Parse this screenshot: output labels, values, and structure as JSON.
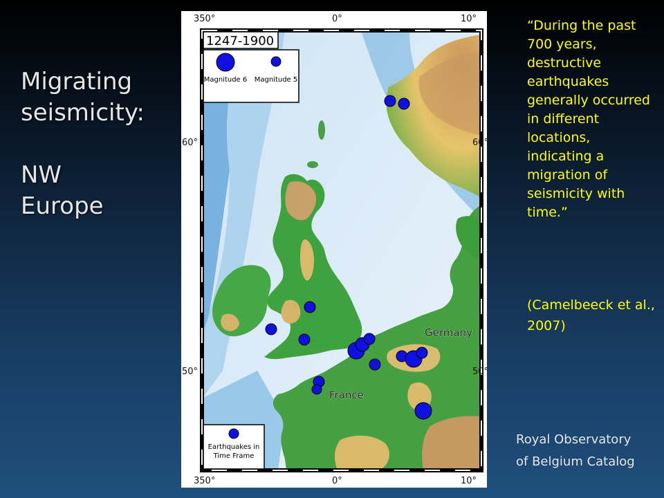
{
  "slide": {
    "title_lines": [
      "Migrating",
      "seismicity:",
      "NW",
      "Europe"
    ],
    "quote": "“During the past 700 years, destructive earthquakes generally occurred in different locations, indicating a migration of seismicity with time.”",
    "citation": "(Camelbeeck et al., 2007)",
    "source_lines": [
      "Royal Observatory",
      "of Belgium Catalog"
    ]
  },
  "map": {
    "period": "1247-1900",
    "legend_magnitude6": "Magnitude 6",
    "legend_magnitude5": "Magnitude 5",
    "legend_timeframe": "Earthquakes in Time Frame",
    "tick_top": [
      "350°",
      "0°",
      "10°"
    ],
    "tick_bottom": [
      "350°",
      "0°",
      "10°"
    ],
    "tick_left": [
      "60°",
      "50°"
    ],
    "tick_right": [
      "60°",
      "50°"
    ],
    "place_labels": [
      "Germany",
      "France"
    ],
    "colors": {
      "sea": "#dfeef8",
      "shelf": "#8fc4e6",
      "land_low": "#2f9a3a",
      "land_mid": "#e9cc6b",
      "land_high": "#b88a55",
      "quake": "#1010e0"
    }
  }
}
